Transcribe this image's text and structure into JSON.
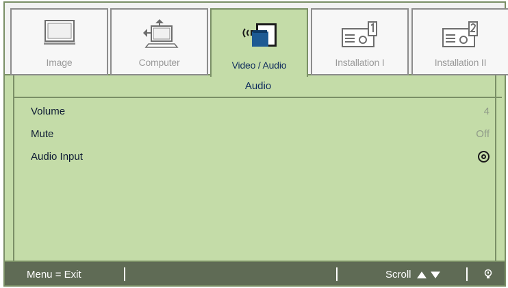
{
  "tabs": [
    {
      "label": "Image",
      "icon": "monitor-icon",
      "active": false
    },
    {
      "label": "Computer",
      "icon": "computer-icon",
      "active": false
    },
    {
      "label": "Video / Audio",
      "icon": "video-audio-icon",
      "active": true
    },
    {
      "label": "Installation I",
      "icon": "projector-icon",
      "active": false
    },
    {
      "label": "Installation II",
      "icon": "projector-settings-icon",
      "active": false
    }
  ],
  "section": {
    "title": "Audio"
  },
  "menu": {
    "items": [
      {
        "label": "Volume",
        "value": "4"
      },
      {
        "label": "Mute",
        "value": "Off"
      },
      {
        "label": "Audio Input",
        "value_icon": "select-icon"
      }
    ]
  },
  "status": {
    "exit": "Menu = Exit",
    "scroll": "Scroll",
    "scroll_icons": [
      "arrow-up-icon",
      "arrow-down-icon"
    ],
    "help_icon": "lightbulb-icon"
  },
  "colors": {
    "menu_background": "#c4dca8",
    "tab_strip_background": "#f2f2f2",
    "status_bar": "#5f6b55",
    "active_text": "#0d2a5c",
    "inactive_text": "#9a9a9a"
  }
}
